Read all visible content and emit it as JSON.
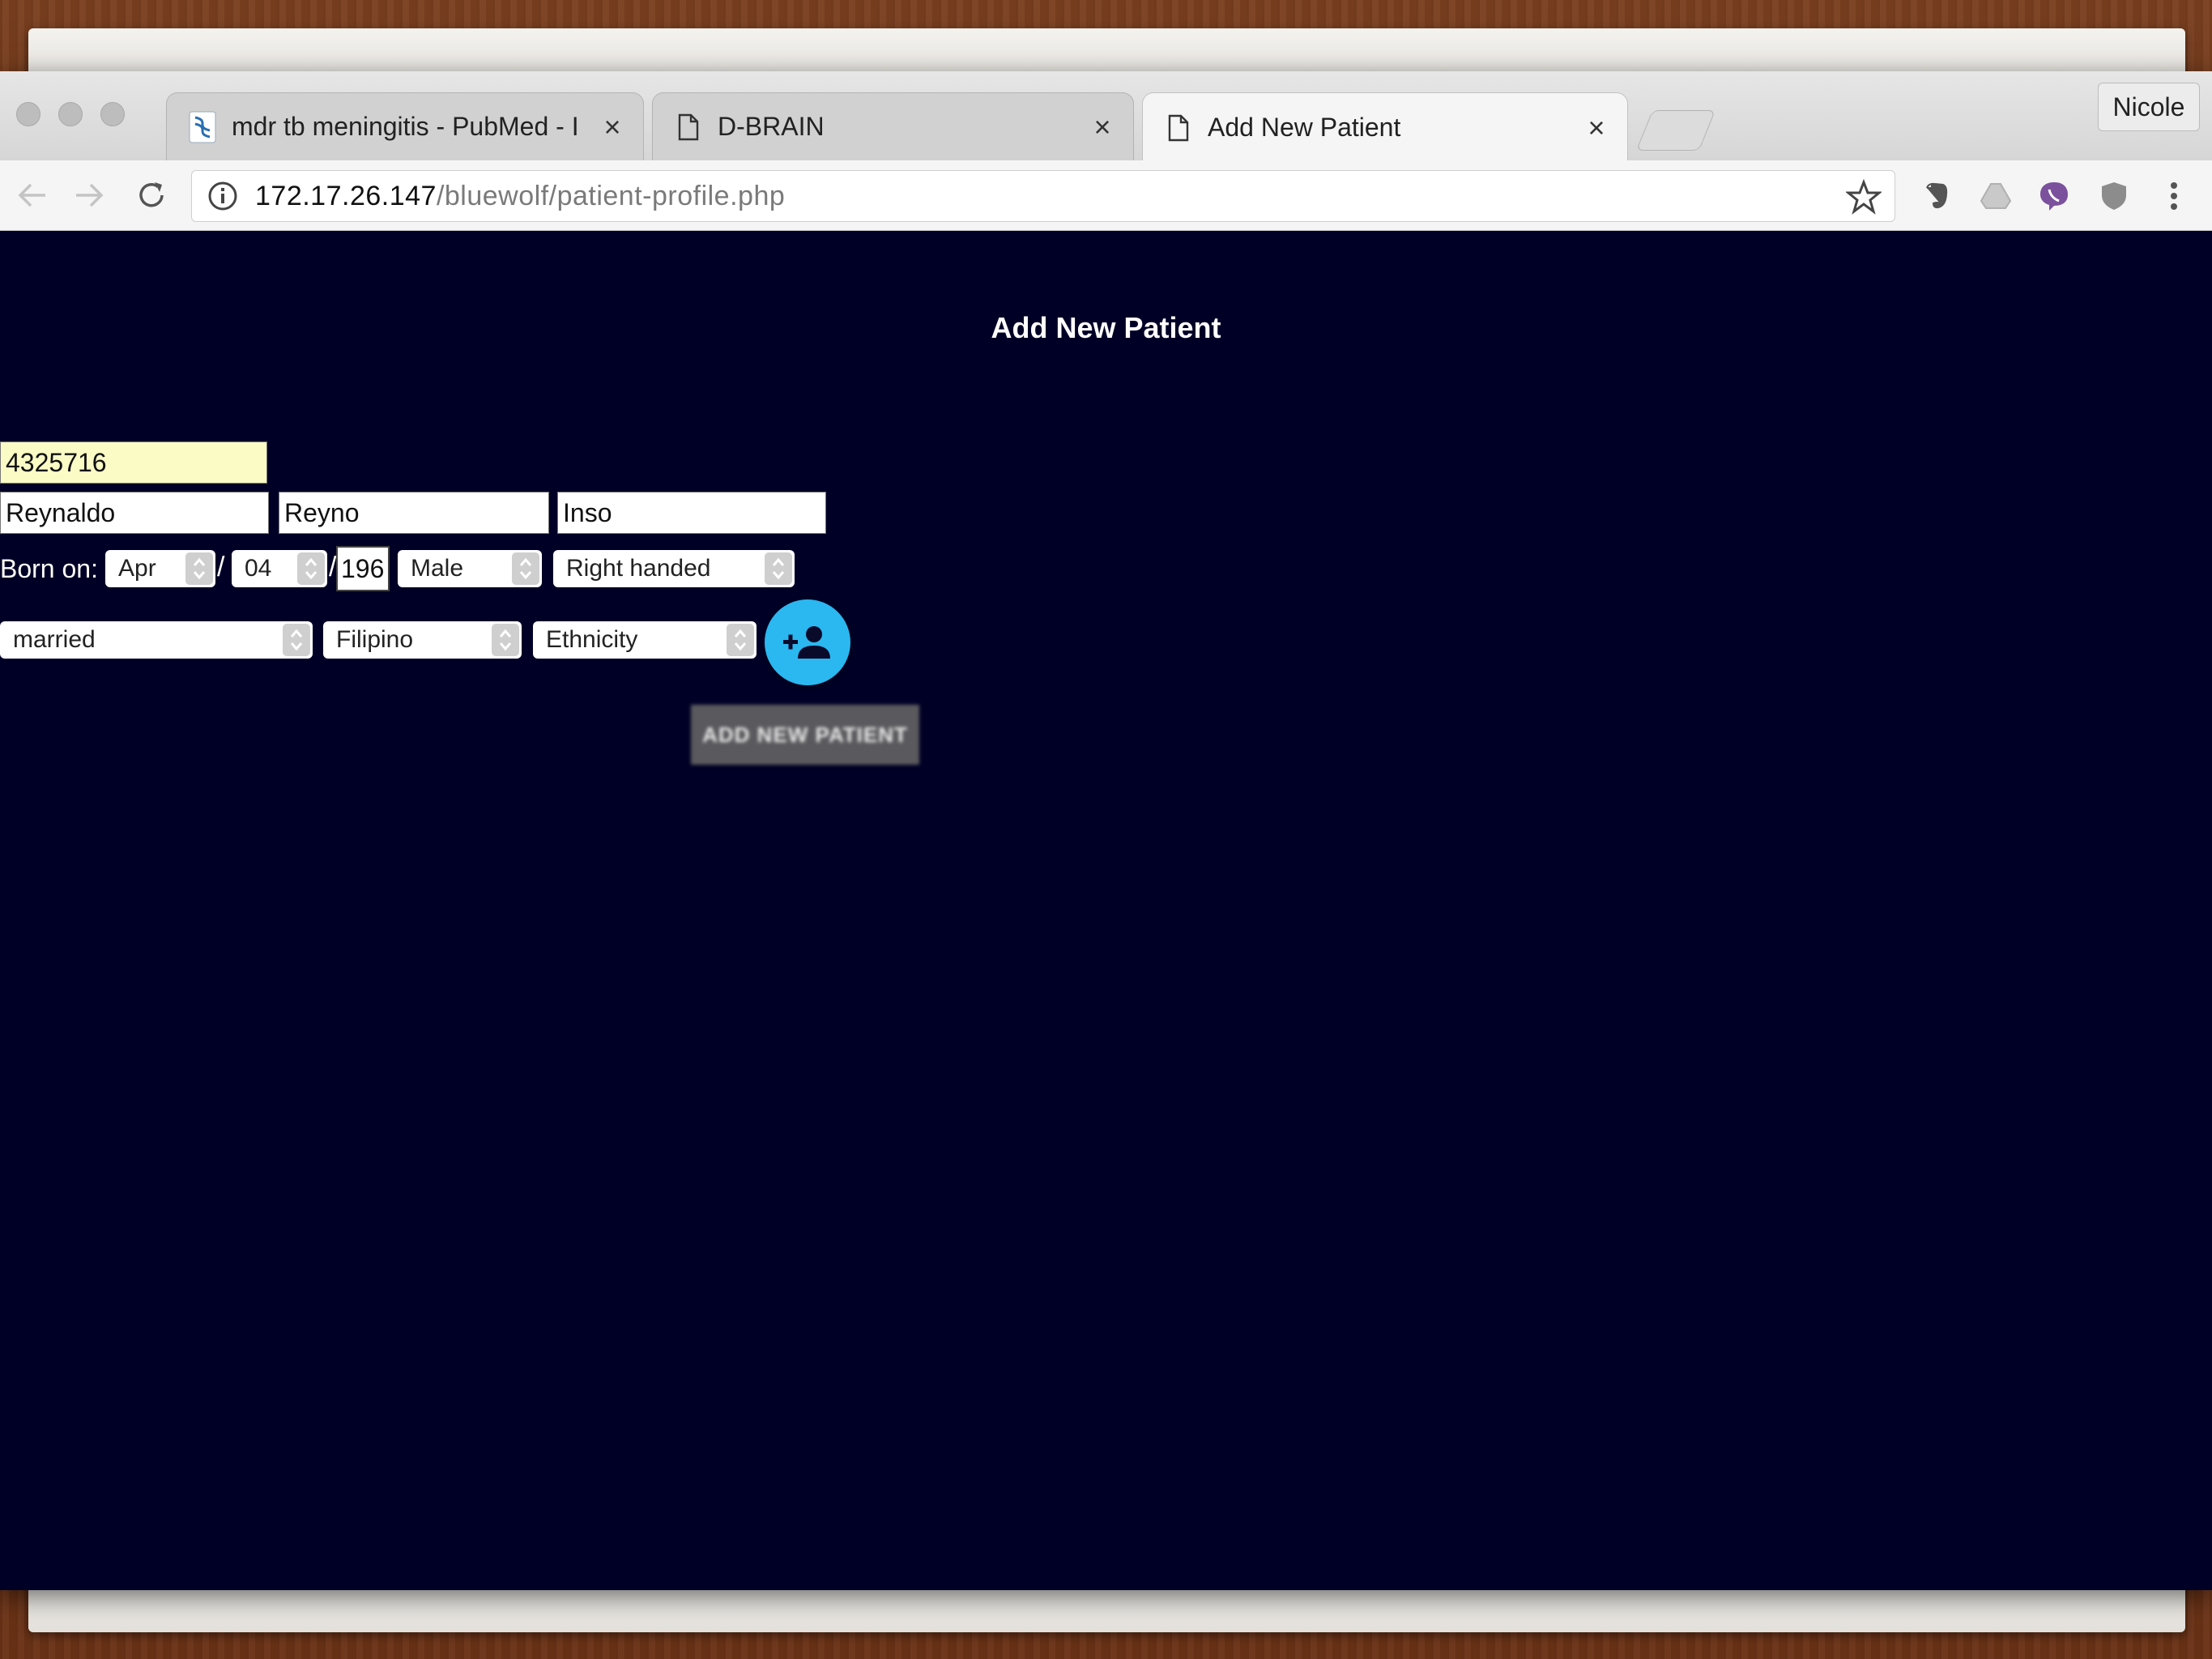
{
  "browser": {
    "tabs": [
      {
        "title": "mdr tb meningitis - PubMed - I",
        "favicon": "pubmed-icon",
        "active": false
      },
      {
        "title": "D-BRAIN",
        "favicon": "page-icon",
        "active": false
      },
      {
        "title": "Add New Patient",
        "favicon": "page-icon",
        "active": true
      }
    ],
    "profile_name": "Nicole",
    "url_host": "172.17.26.147",
    "url_path": "/bluewolf/patient-profile.php"
  },
  "page": {
    "title": "Add New Patient",
    "patient_id": "4325716",
    "first_name": "Reynaldo",
    "middle_name": "Reyno",
    "last_name": "Inso",
    "born_on_label": "Born on:",
    "birth_month": "Apr",
    "birth_day": "04",
    "birth_year": "196",
    "sex": "Male",
    "handedness": "Right handed",
    "civil_status": "married",
    "nationality": "Filipino",
    "ethnicity": "Ethnicity",
    "add_button_label": "ADD NEW PATIENT",
    "colors": {
      "page_background": "#000026",
      "id_field": "#fbfbc6",
      "fab": "#2bb7f0",
      "add_button": "#5a5a5e"
    }
  }
}
